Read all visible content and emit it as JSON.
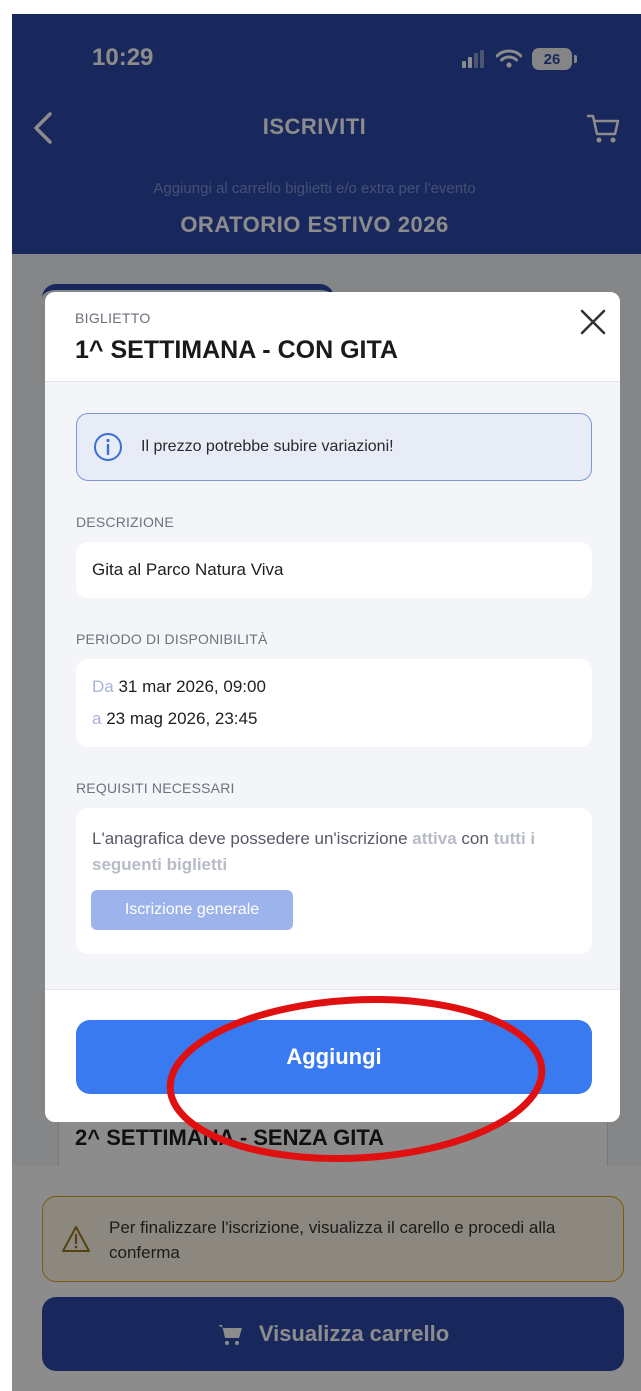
{
  "status_bar": {
    "time": "10:29",
    "battery": "26"
  },
  "header": {
    "title": "ISCRIVITI",
    "subtitle": "Aggiungi al carrello biglietti e/o extra per l'evento",
    "event": "ORATORIO ESTIVO 2026"
  },
  "background": {
    "card_title": "2^ SETTIMANA - SENZA GITA",
    "notice": "Per finalizzare l'iscrizione, visualizza il carello e procedi alla conferma",
    "cart_button": "Visualizza carrello"
  },
  "modal": {
    "kicker": "BIGLIETTO",
    "title": "1^ SETTIMANA - CON GITA",
    "info": "Il prezzo potrebbe subire variazioni!",
    "description": {
      "label": "DESCRIZIONE",
      "value": "Gita al Parco Natura Viva"
    },
    "availability": {
      "label": "PERIODO DI DISPONIBILITÀ",
      "from_prefix": "Da",
      "from": "31 mar 2026, 09:00",
      "to_prefix": "a",
      "to": "23 mag 2026, 23:45"
    },
    "requirements": {
      "label": "REQUISITI NECESSARI",
      "text_1": "L'anagrafica deve possedere un'iscrizione",
      "text_bold_1": "attiva",
      "text_2": "con",
      "text_bold_2": "tutti i seguenti biglietti",
      "chip": "Iscrizione generale"
    },
    "add_button": "Aggiungi"
  },
  "colors": {
    "header_blue": "#2f4aa8",
    "primary_button": "#3a7af0",
    "annotation_red": "#e01010",
    "warning": "#e6a400"
  }
}
